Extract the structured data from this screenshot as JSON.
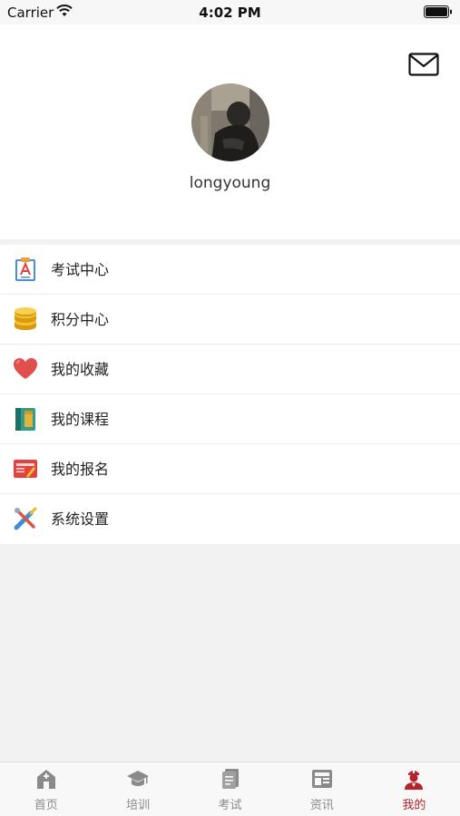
{
  "status_bar": {
    "carrier": "Carrier",
    "time": "4:02 PM"
  },
  "profile": {
    "username": "longyoung",
    "mail_icon": "envelope-icon"
  },
  "menu": {
    "items": [
      {
        "label": "考试中心",
        "icon": "exam-clipboard-icon"
      },
      {
        "label": "积分中心",
        "icon": "coins-icon"
      },
      {
        "label": "我的收藏",
        "icon": "heart-icon"
      },
      {
        "label": "我的课程",
        "icon": "notebook-icon"
      },
      {
        "label": "我的报名",
        "icon": "exam-registration-icon"
      },
      {
        "label": "系统设置",
        "icon": "tools-icon"
      }
    ]
  },
  "tabbar": {
    "active_color": "#b3252c",
    "inactive_color": "#8a8a8a",
    "tabs": [
      {
        "label": "首页",
        "icon": "home-icon"
      },
      {
        "label": "培训",
        "icon": "graduation-cap-icon"
      },
      {
        "label": "考试",
        "icon": "exam-paper-icon"
      },
      {
        "label": "资讯",
        "icon": "news-icon"
      },
      {
        "label": "我的",
        "icon": "user-icon",
        "active": true
      }
    ]
  }
}
